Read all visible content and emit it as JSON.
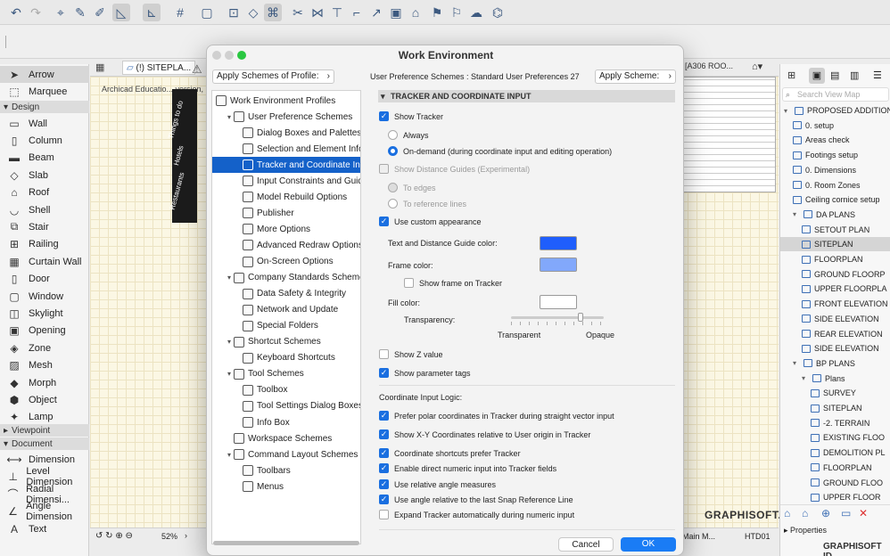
{
  "toolbar": {
    "icons": [
      "undo-icon",
      "redo-icon",
      "arrow-icon",
      "eyedropper-icon",
      "syringe-icon",
      "guide-icon",
      "snap-icon",
      "grid-icon",
      "box-icon",
      "tracker-icon",
      "view-icon",
      "magic-wand-icon",
      "scissors-icon",
      "offset-icon",
      "trim-icon",
      "resize-icon",
      "split-icon",
      "home-icon",
      "flag-icon",
      "cloud-icon",
      "publish-icon"
    ]
  },
  "toolbox": {
    "arrow": "Arrow",
    "marquee": "Marquee",
    "design_section": "Design",
    "design_tools": [
      "Wall",
      "Column",
      "Beam",
      "Slab",
      "Roof",
      "Shell",
      "Stair",
      "Railing",
      "Curtain Wall",
      "Door",
      "Window",
      "Skylight",
      "Opening",
      "Zone",
      "Mesh",
      "Morph",
      "Object",
      "Lamp"
    ],
    "viewpoint_section": "Viewpoint",
    "document_section": "Document",
    "document_tools": [
      "Dimension",
      "Level Dimension",
      "Radial Dimensi...",
      "Angle Dimension",
      "Text"
    ]
  },
  "canvas": {
    "tab_label": "(!) SITEPLA...",
    "note": "Archicad Educatio... version, not f...",
    "map_labels": [
      "Things to do",
      "Hotels",
      "Restaurants"
    ],
    "right_tab": "[A306 ROO...",
    "zoom": "52%",
    "status_right": "Main M...",
    "status_code": "HTD01",
    "logo": "GRAPHISOFT."
  },
  "navigator": {
    "search_placeholder": "Search View Map",
    "items": [
      {
        "label": "PROPOSED ADDITIONS",
        "level": 0,
        "caret": "▾"
      },
      {
        "label": "0. setup",
        "level": 1
      },
      {
        "label": "Areas check",
        "level": 1
      },
      {
        "label": "Footings setup",
        "level": 1
      },
      {
        "label": "0. Dimensions",
        "level": 1
      },
      {
        "label": "0. Room Zones",
        "level": 1
      },
      {
        "label": "Ceiling cornice setup",
        "level": 1
      },
      {
        "label": "DA PLANS",
        "level": 1,
        "caret": "▾"
      },
      {
        "label": "SETOUT PLAN",
        "level": 2
      },
      {
        "label": "SITEPLAN",
        "level": 2,
        "selected": true
      },
      {
        "label": "FLOORPLAN",
        "level": 2
      },
      {
        "label": "GROUND FLOORP",
        "level": 2
      },
      {
        "label": "UPPER FLOORPLA",
        "level": 2
      },
      {
        "label": "FRONT ELEVATION",
        "level": 2
      },
      {
        "label": "SIDE ELEVATION",
        "level": 2
      },
      {
        "label": "REAR ELEVATION",
        "level": 2
      },
      {
        "label": "SIDE ELEVATION",
        "level": 2
      },
      {
        "label": "BP PLANS",
        "level": 1,
        "caret": "▾"
      },
      {
        "label": "Plans",
        "level": 2,
        "caret": "▾"
      },
      {
        "label": "SURVEY",
        "level": 3
      },
      {
        "label": "SITEPLAN",
        "level": 3
      },
      {
        "label": "-2. TERRAIN",
        "level": 3
      },
      {
        "label": "EXISTING FLOO",
        "level": 3
      },
      {
        "label": "DEMOLITION PL",
        "level": 3
      },
      {
        "label": "FLOORPLAN",
        "level": 3
      },
      {
        "label": "GROUND FLOO",
        "level": 3
      },
      {
        "label": "UPPER FLOOR",
        "level": 3
      }
    ],
    "properties": "Properties",
    "logo": "GRAPHISOFT ID"
  },
  "dialog": {
    "title": "Work Environment",
    "apply_profile_label": "Apply Schemes of Profile:",
    "user_pref_label": "User Preference Schemes : Standard User Preferences 27",
    "apply_scheme_label": "Apply Scheme:",
    "tree": [
      {
        "label": "Work Environment Profiles",
        "level": 0
      },
      {
        "label": "User Preference Schemes",
        "level": 1,
        "caret": "▾"
      },
      {
        "label": "Dialog Boxes and Palettes",
        "level": 2
      },
      {
        "label": "Selection and Element Informatic",
        "level": 2
      },
      {
        "label": "Tracker and Coordinate Input",
        "level": 2,
        "selected": true
      },
      {
        "label": "Input Constraints and Guides",
        "level": 2
      },
      {
        "label": "Model Rebuild Options",
        "level": 2
      },
      {
        "label": "Publisher",
        "level": 2
      },
      {
        "label": "More Options",
        "level": 2
      },
      {
        "label": "Advanced Redraw Options",
        "level": 2
      },
      {
        "label": "On-Screen Options",
        "level": 2
      },
      {
        "label": "Company Standards Schemes",
        "level": 1,
        "caret": "▾"
      },
      {
        "label": "Data Safety & Integrity",
        "level": 2
      },
      {
        "label": "Network and Update",
        "level": 2
      },
      {
        "label": "Special Folders",
        "level": 2
      },
      {
        "label": "Shortcut Schemes",
        "level": 1,
        "caret": "▾"
      },
      {
        "label": "Keyboard Shortcuts",
        "level": 2
      },
      {
        "label": "Tool Schemes",
        "level": 1,
        "caret": "▾"
      },
      {
        "label": "Toolbox",
        "level": 2
      },
      {
        "label": "Tool Settings Dialog Boxes",
        "level": 2
      },
      {
        "label": "Info Box",
        "level": 2
      },
      {
        "label": "Workspace Schemes",
        "level": 1
      },
      {
        "label": "Command Layout Schemes",
        "level": 1,
        "caret": "▾"
      },
      {
        "label": "Toolbars",
        "level": 2
      },
      {
        "label": "Menus",
        "level": 2
      }
    ],
    "panel": {
      "header": "TRACKER AND COORDINATE INPUT",
      "show_tracker": "Show Tracker",
      "always": "Always",
      "on_demand": "On-demand (during coordinate input and editing operation)",
      "show_distance_guides": "Show Distance Guides (Experimental)",
      "to_edges": "To edges",
      "to_reference_lines": "To reference lines",
      "use_custom_appearance": "Use custom appearance",
      "text_guide_color_label": "Text and Distance Guide color:",
      "text_guide_color": "#1f5efc",
      "frame_color_label": "Frame color:",
      "frame_color": "#82a8fb",
      "show_frame": "Show frame on Tracker",
      "fill_color_label": "Fill color:",
      "fill_color": "#ffffff",
      "transparency_label": "Transparency:",
      "transparency_value": 0.77,
      "transparent": "Transparent",
      "opaque": "Opaque",
      "show_z": "Show Z value",
      "show_param_tags": "Show parameter tags",
      "logic_label": "Coordinate Input Logic:",
      "prefer_polar": "Prefer polar coordinates in Tracker during straight vector input",
      "show_xy": "Show X-Y Coordinates relative to User origin in Tracker",
      "shortcuts_prefer": "Coordinate shortcuts prefer Tracker",
      "direct_numeric": "Enable direct numeric input into Tracker fields",
      "relative_angle": "Use relative angle measures",
      "angle_snap": "Use angle relative to the last Snap Reference Line",
      "expand_tracker": "Expand Tracker automatically during numeric input"
    },
    "cancel": "Cancel",
    "ok": "OK"
  }
}
